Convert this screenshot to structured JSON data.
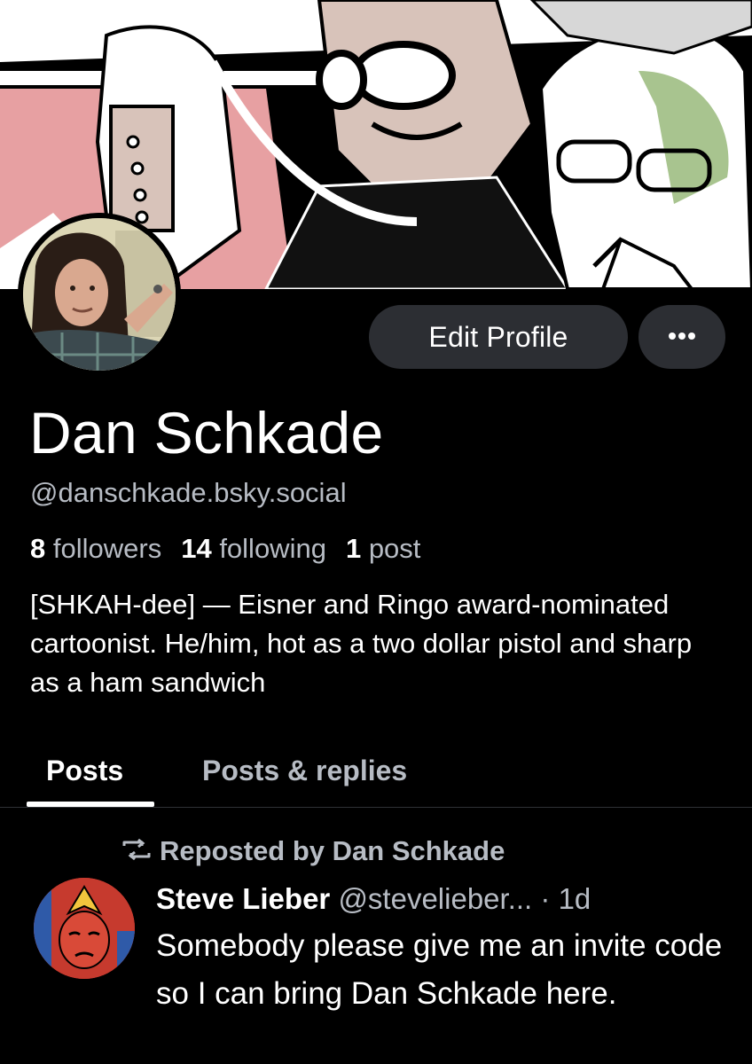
{
  "profile": {
    "display_name": "Dan Schkade",
    "handle": "@danschkade.bsky.social",
    "followers_count": "8",
    "followers_label": "followers",
    "following_count": "14",
    "following_label": "following",
    "posts_count": "1",
    "posts_label": "post",
    "bio": "[SHKAH-dee] — Eisner and Ringo award-nominated cartoonist. He/him, hot as a two dollar pistol and sharp as a ham sandwich"
  },
  "actions": {
    "edit_profile_label": "Edit Profile",
    "more_icon": "ellipsis-icon"
  },
  "tabs": [
    {
      "label": "Posts",
      "active": true
    },
    {
      "label": "Posts & replies",
      "active": false
    }
  ],
  "feed": {
    "items": [
      {
        "repost_label": "Reposted by Dan Schkade",
        "author": "Steve Lieber",
        "handle": "@stevelieber...",
        "separator": "·",
        "time": "1d",
        "text": "Somebody please give me an invite code so I can bring Dan Schkade here."
      }
    ]
  },
  "colors": {
    "background": "#000000",
    "secondary_text": "#b7bcc4",
    "button_bg": "#2c2e33"
  }
}
